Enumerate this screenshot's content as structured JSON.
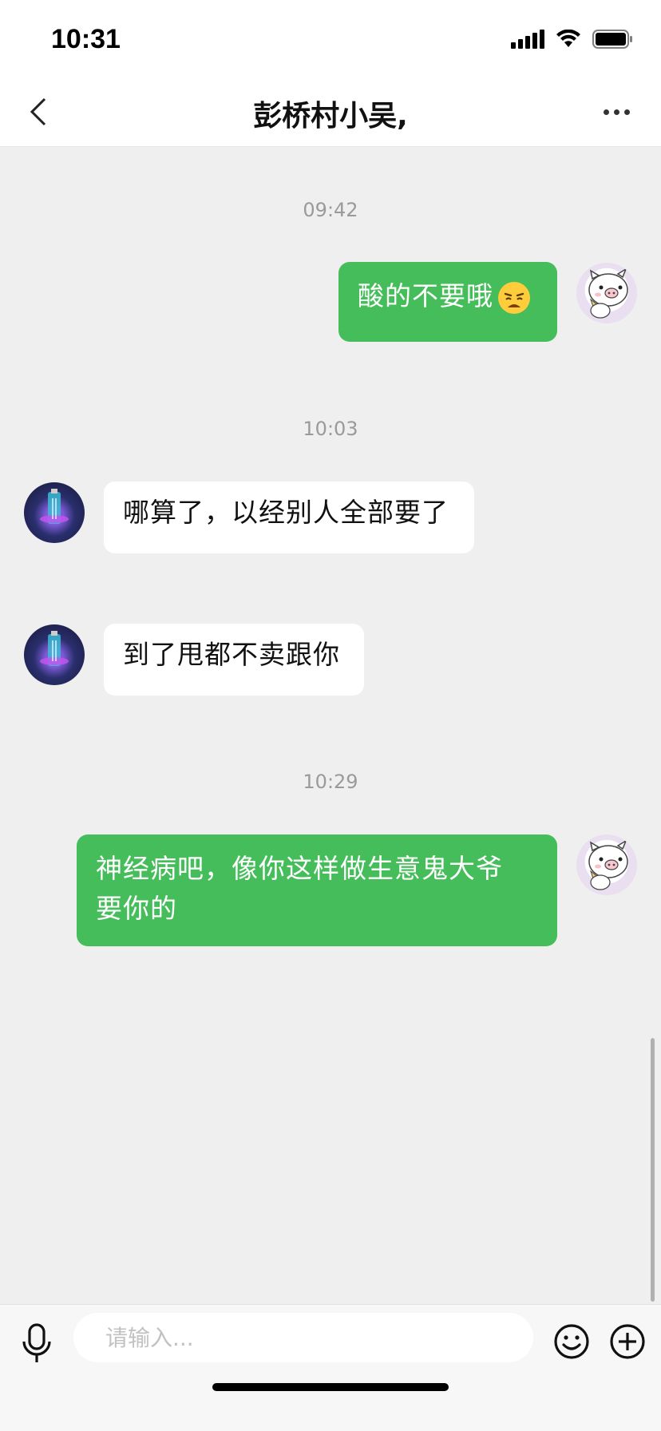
{
  "status_bar": {
    "time": "10:31"
  },
  "header": {
    "title": "彭桥村小吴,"
  },
  "messages": [
    {
      "type": "timestamp",
      "text": "09:42"
    },
    {
      "type": "message",
      "sender": "me",
      "text": "酸的不要哦",
      "emoji": "weary-face-emoji"
    },
    {
      "type": "timestamp",
      "text": "10:03"
    },
    {
      "type": "message",
      "sender": "contact",
      "text": "哪算了，以经别人全部要了"
    },
    {
      "type": "message",
      "sender": "contact",
      "text": "到了甩都不卖跟你"
    },
    {
      "type": "timestamp",
      "text": "10:29"
    },
    {
      "type": "message",
      "sender": "me",
      "text": "神经病吧，像你这样做生意鬼大爷\n要你的"
    }
  ],
  "input": {
    "placeholder": "请输入..."
  },
  "colors": {
    "outgoing_bubble": "#45bd5a",
    "incoming_bubble": "#ffffff",
    "chat_background": "#efefef"
  }
}
